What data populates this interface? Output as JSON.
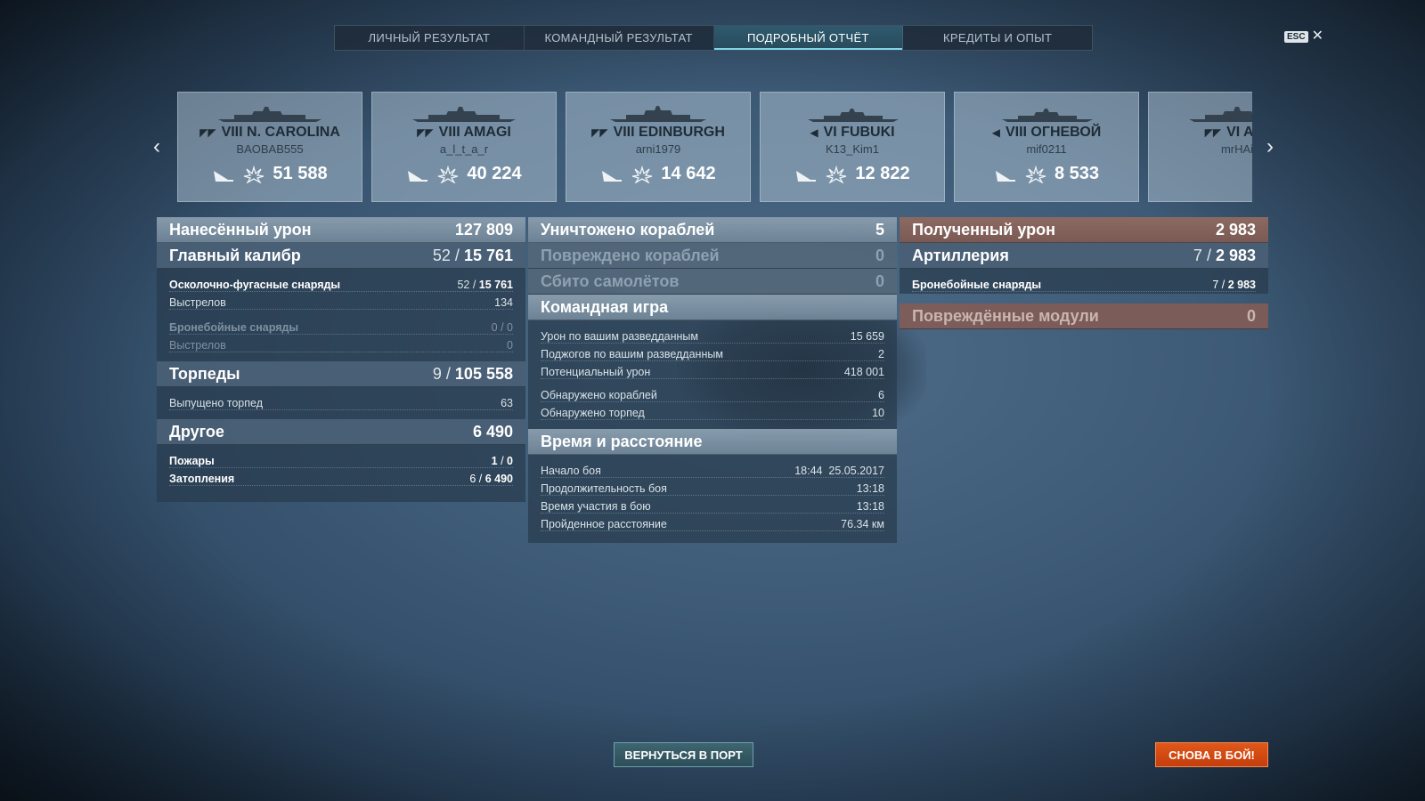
{
  "tabs": [
    {
      "label": "ЛИЧНЫЙ РЕЗУЛЬТАТ"
    },
    {
      "label": "КОМАНДНЫЙ РЕЗУЛЬТАТ"
    },
    {
      "label": "ПОДРОБНЫЙ ОТЧЁТ"
    },
    {
      "label": "КРЕДИТЫ И ОПЫТ"
    }
  ],
  "active_tab": "ПОДРОБНЫЙ ОТЧЁТ",
  "esc": {
    "key": "ESC",
    "close": "✕"
  },
  "ships": [
    {
      "name": "VIII N. CAROLINA",
      "player": "BAOBAB555",
      "damage": "51 588"
    },
    {
      "name": "VIII AMAGI",
      "player": "a_l_t_a_r",
      "damage": "40 224"
    },
    {
      "name": "VIII EDINBURGH",
      "player": "arni1979",
      "damage": "14 642"
    },
    {
      "name": "VI FUBUKI",
      "player": "K13_Kim1",
      "damage": "12 822"
    },
    {
      "name": "VIII ОГНЕВОЙ",
      "player": "mif0211",
      "damage": "8 533"
    },
    {
      "name": "VI ARIZ",
      "player": "mrHAiT",
      "damage": ""
    }
  ],
  "damage": {
    "title": "Нанесённый урон",
    "total": "127 809",
    "main": {
      "label": "Главный калибр",
      "hits": "52",
      "dmg": "15 761"
    },
    "he": {
      "label": "Осколочно-фугасные снаряды",
      "hits": "52",
      "dmg": "15 761"
    },
    "he_shots": {
      "label": "Выстрелов",
      "value": "134"
    },
    "ap": {
      "label": "Бронебойные снаряды",
      "value": "0 / 0"
    },
    "ap_shots": {
      "label": "Выстрелов",
      "value": "0"
    },
    "torp": {
      "label": "Торпеды",
      "hits": "9",
      "dmg": "105 558"
    },
    "torp_fired": {
      "label": "Выпущено торпед",
      "value": "63"
    },
    "other": {
      "label": "Другое",
      "value": "6 490"
    },
    "fires": {
      "label": "Пожары",
      "count": "1",
      "dmg": "0"
    },
    "floods": {
      "label": "Затопления",
      "count": "6",
      "dmg": "6 490"
    }
  },
  "kills": {
    "destroyed": {
      "label": "Уничтожено кораблей",
      "value": "5"
    },
    "damaged": {
      "label": "Повреждено кораблей",
      "value": "0"
    },
    "planes": {
      "label": "Сбито самолётов",
      "value": "0"
    },
    "team": {
      "title": "Командная игра",
      "rows": [
        {
          "label": "Урон по вашим разведданным",
          "value": "15 659"
        },
        {
          "label": "Поджогов по вашим разведданным",
          "value": "2"
        },
        {
          "label": "Потенциальный урон",
          "value": "418 001"
        },
        {
          "label": "Обнаружено кораблей",
          "value": "6"
        },
        {
          "label": "Обнаружено торпед",
          "value": "10"
        }
      ]
    },
    "time": {
      "title": "Время и расстояние",
      "rows": [
        {
          "label": "Начало боя",
          "value": "18:44  25.05.2017"
        },
        {
          "label": "Продолжительность боя",
          "value": "13:18"
        },
        {
          "label": "Время участия в бою",
          "value": "13:18"
        },
        {
          "label": "Пройденное расстояние",
          "value": "76.34 км"
        }
      ]
    }
  },
  "received": {
    "title": "Полученный урон",
    "total": "2 983",
    "artillery": {
      "label": "Артиллерия",
      "hits": "7",
      "dmg": "2 983"
    },
    "ap": {
      "label": "Бронебойные снаряды",
      "hits": "7",
      "dmg": "2 983"
    },
    "modules": {
      "label": "Повреждённые модули",
      "value": "0"
    }
  },
  "buttons": {
    "port": "ВЕРНУТЬСЯ В ПОРТ",
    "fight": "СНОВА В БОЙ!"
  },
  "icons": {
    "ship_class": "class-icon",
    "stats": [
      "ship-sink-icon",
      "damage-burst-icon"
    ],
    "nav": [
      "chevron-left-icon",
      "chevron-right-icon"
    ]
  },
  "colors": {
    "accent_tab": "#7fd6e6",
    "fight_button": "#e2571a",
    "received_header": "#8c6a62"
  }
}
